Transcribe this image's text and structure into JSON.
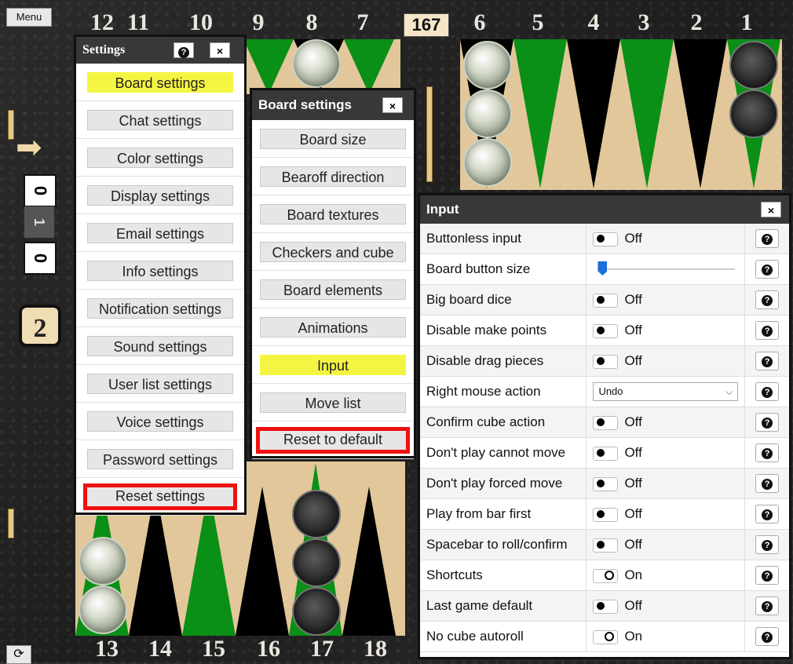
{
  "menu_label": "Menu",
  "pip_count": "167",
  "top_numbers": [
    "12",
    "11",
    "10",
    "9",
    "8",
    "7",
    "6",
    "5",
    "4",
    "3",
    "2",
    "1"
  ],
  "bottom_numbers": [
    "13",
    "14",
    "15",
    "16",
    "17",
    "18"
  ],
  "score_top": "0",
  "score_mid": "1",
  "score_bottom": "0",
  "cube_value": "2",
  "settings": {
    "title": "Settings",
    "help": "?",
    "close": "×",
    "items": [
      {
        "label": "Board settings",
        "style": "hl"
      },
      {
        "label": "Chat settings",
        "style": ""
      },
      {
        "label": "Color settings",
        "style": ""
      },
      {
        "label": "Display settings",
        "style": ""
      },
      {
        "label": "Email settings",
        "style": ""
      },
      {
        "label": "Info settings",
        "style": ""
      },
      {
        "label": "Notification settings",
        "style": ""
      },
      {
        "label": "Sound settings",
        "style": ""
      },
      {
        "label": "User list settings",
        "style": ""
      },
      {
        "label": "Voice settings",
        "style": ""
      },
      {
        "label": "Password settings",
        "style": ""
      },
      {
        "label": "Reset settings",
        "style": "red"
      }
    ]
  },
  "board_settings": {
    "title": "Board settings",
    "close": "×",
    "items": [
      {
        "label": "Board size",
        "style": ""
      },
      {
        "label": "Bearoff direction",
        "style": ""
      },
      {
        "label": "Board textures",
        "style": ""
      },
      {
        "label": "Checkers and cube",
        "style": ""
      },
      {
        "label": "Board elements",
        "style": ""
      },
      {
        "label": "Animations",
        "style": ""
      },
      {
        "label": "Input",
        "style": "hl"
      },
      {
        "label": "Move list",
        "style": ""
      },
      {
        "label": "Reset to default",
        "style": "red"
      }
    ]
  },
  "input": {
    "title": "Input",
    "close": "×",
    "rows": [
      {
        "label": "Buttonless input",
        "type": "toggle",
        "state": "off",
        "value": "Off"
      },
      {
        "label": "Board button size",
        "type": "slider",
        "level": 0
      },
      {
        "label": "Big board dice",
        "type": "toggle",
        "state": "off",
        "value": "Off"
      },
      {
        "label": "Disable make points",
        "type": "toggle",
        "state": "off",
        "value": "Off"
      },
      {
        "label": "Disable drag pieces",
        "type": "toggle",
        "state": "off",
        "value": "Off"
      },
      {
        "label": "Right mouse action",
        "type": "select",
        "value": "Undo"
      },
      {
        "label": "Confirm cube action",
        "type": "toggle",
        "state": "off",
        "value": "Off"
      },
      {
        "label": "Don't play cannot move",
        "type": "toggle",
        "state": "off",
        "value": "Off"
      },
      {
        "label": "Don't play forced move",
        "type": "toggle",
        "state": "off",
        "value": "Off"
      },
      {
        "label": "Play from bar first",
        "type": "toggle",
        "state": "off",
        "value": "Off"
      },
      {
        "label": "Spacebar to roll/confirm",
        "type": "toggle",
        "state": "off",
        "value": "Off"
      },
      {
        "label": "Shortcuts",
        "type": "toggle",
        "state": "on",
        "value": "On"
      },
      {
        "label": "Last game default",
        "type": "toggle",
        "state": "off",
        "value": "Off"
      },
      {
        "label": "No cube autoroll",
        "type": "toggle",
        "state": "on",
        "value": "On"
      }
    ]
  },
  "colors": {
    "green": "#0a8f17",
    "black": "#000000",
    "wood": "#e2c79a"
  }
}
